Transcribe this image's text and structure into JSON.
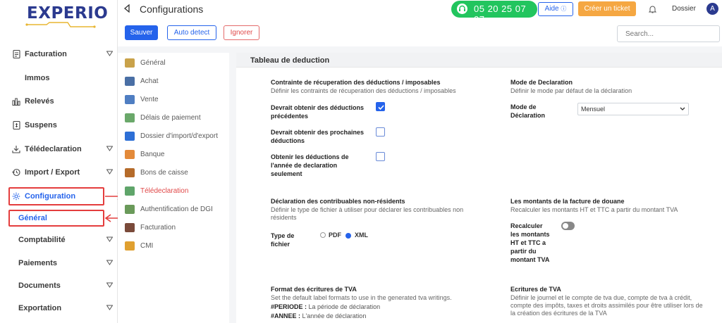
{
  "brand": {
    "logo_text": "EXPERIO"
  },
  "sidebar": {
    "items": [
      {
        "label": "Facturation",
        "icon": "document-icon",
        "has_chevron": true
      },
      {
        "label": "Immos",
        "icon": "",
        "has_chevron": false
      },
      {
        "label": "Relevés",
        "icon": "bar-chart-icon",
        "has_chevron": false
      },
      {
        "label": "Suspens",
        "icon": "receipt-icon",
        "has_chevron": false
      },
      {
        "label": "Télédeclaration",
        "icon": "download-icon",
        "has_chevron": true
      },
      {
        "label": "Import / Export",
        "icon": "history-icon",
        "has_chevron": true
      },
      {
        "label": "Configuration",
        "icon": "gear-icon",
        "has_chevron": false
      },
      {
        "label": "Général",
        "icon": "",
        "has_chevron": false
      },
      {
        "label": "Comptabilité",
        "icon": "",
        "has_chevron": true
      },
      {
        "label": "Paiements",
        "icon": "",
        "has_chevron": true
      },
      {
        "label": "Documents",
        "icon": "",
        "has_chevron": true
      },
      {
        "label": "Exportation",
        "icon": "",
        "has_chevron": true
      }
    ]
  },
  "header": {
    "title": "Configurations",
    "phone": "05 20 25 07 07",
    "aide_label": "Aide",
    "ticket_label": "Créer un ticket",
    "dossier_label": "Dossier",
    "avatar_letter": "A"
  },
  "toolbar": {
    "save_label": "Sauver",
    "auto_label": "Auto detect",
    "ignore_label": "Ignorer",
    "search_placeholder": "Search..."
  },
  "submenu": {
    "items": [
      {
        "label": "Général",
        "color": "#c9a24a"
      },
      {
        "label": "Achat",
        "color": "#4a6fa5"
      },
      {
        "label": "Vente",
        "color": "#4f7ec2"
      },
      {
        "label": "Délais de paiement",
        "color": "#6aa86a"
      },
      {
        "label": "Dossier d'import/d'export",
        "color": "#2d6fd6"
      },
      {
        "label": "Banque",
        "color": "#e38a3a"
      },
      {
        "label": "Bons de caisse",
        "color": "#b56b2a"
      },
      {
        "label": "Télédeclaration",
        "color": "#5fa56a"
      },
      {
        "label": "Authentification de DGI",
        "color": "#6a9a5a"
      },
      {
        "label": "Facturation",
        "color": "#7a4a3a"
      },
      {
        "label": "CMI",
        "color": "#e0a030"
      }
    ]
  },
  "main": {
    "heading": "Tableau de deduction",
    "contraintes": {
      "title": "Contrainte de récuperation des déductions / imposables",
      "desc": "Définir les contraints de récuperation des déductions / imposables",
      "options": [
        {
          "label_l1": "Devrait obtenir des déductions",
          "label_l2": "précédentes",
          "label_l3": "",
          "checked": true
        },
        {
          "label_l1": "Devrait obtenir des prochaines",
          "label_l2": "déductions",
          "label_l3": "",
          "checked": false
        },
        {
          "label_l1": "Obtenir les déductions de",
          "label_l2": "l'année de declaration",
          "label_l3": "seulement",
          "checked": false
        }
      ]
    },
    "mode": {
      "title": "Mode de Declaration",
      "desc": "Définir le mode par défaut de la déclaration",
      "label_l1": "Mode de",
      "label_l2": "Déclaration",
      "value": "Mensuel"
    },
    "nonresidents": {
      "title": "Déclaration des contribuables non-résidents",
      "desc_l1": "Définir le type de fichier à utiliser pour déclarer les contribuables non",
      "desc_l2": "résidents",
      "type_l1": "Type de",
      "type_l2": "fichier",
      "opt_pdf": "PDF",
      "opt_xml": "XML",
      "selected": "XML"
    },
    "douane": {
      "title": "Les montants de la facture de douane",
      "desc": "Recalculer les montants HT et TTC a partir du montant TVA",
      "label_l1": "Recalculer",
      "label_l2": "les montants",
      "label_l3": "HT et TTC a",
      "label_l4": "partir du",
      "label_l5": "montant TVA",
      "toggle_on": false
    },
    "format": {
      "title": "Format des écritures de TVA",
      "desc": "Set the default label formats to use in the generated tva writings.",
      "line1_key": "#PERIODE :",
      "line1_val": "La période de déclaration",
      "line2_key": "#ANNEE :",
      "line2_val": "L'année de déclaration"
    },
    "ecritures": {
      "title": "Ecritures de TVA",
      "desc_l1": "Définir le journel et le compte de tva due, compte de tva à crédit,",
      "desc_l2": "compte des impôts, taxes et droits assimilés pour être utiliser lors de",
      "desc_l3": "la création des écritures de la TVA"
    }
  }
}
